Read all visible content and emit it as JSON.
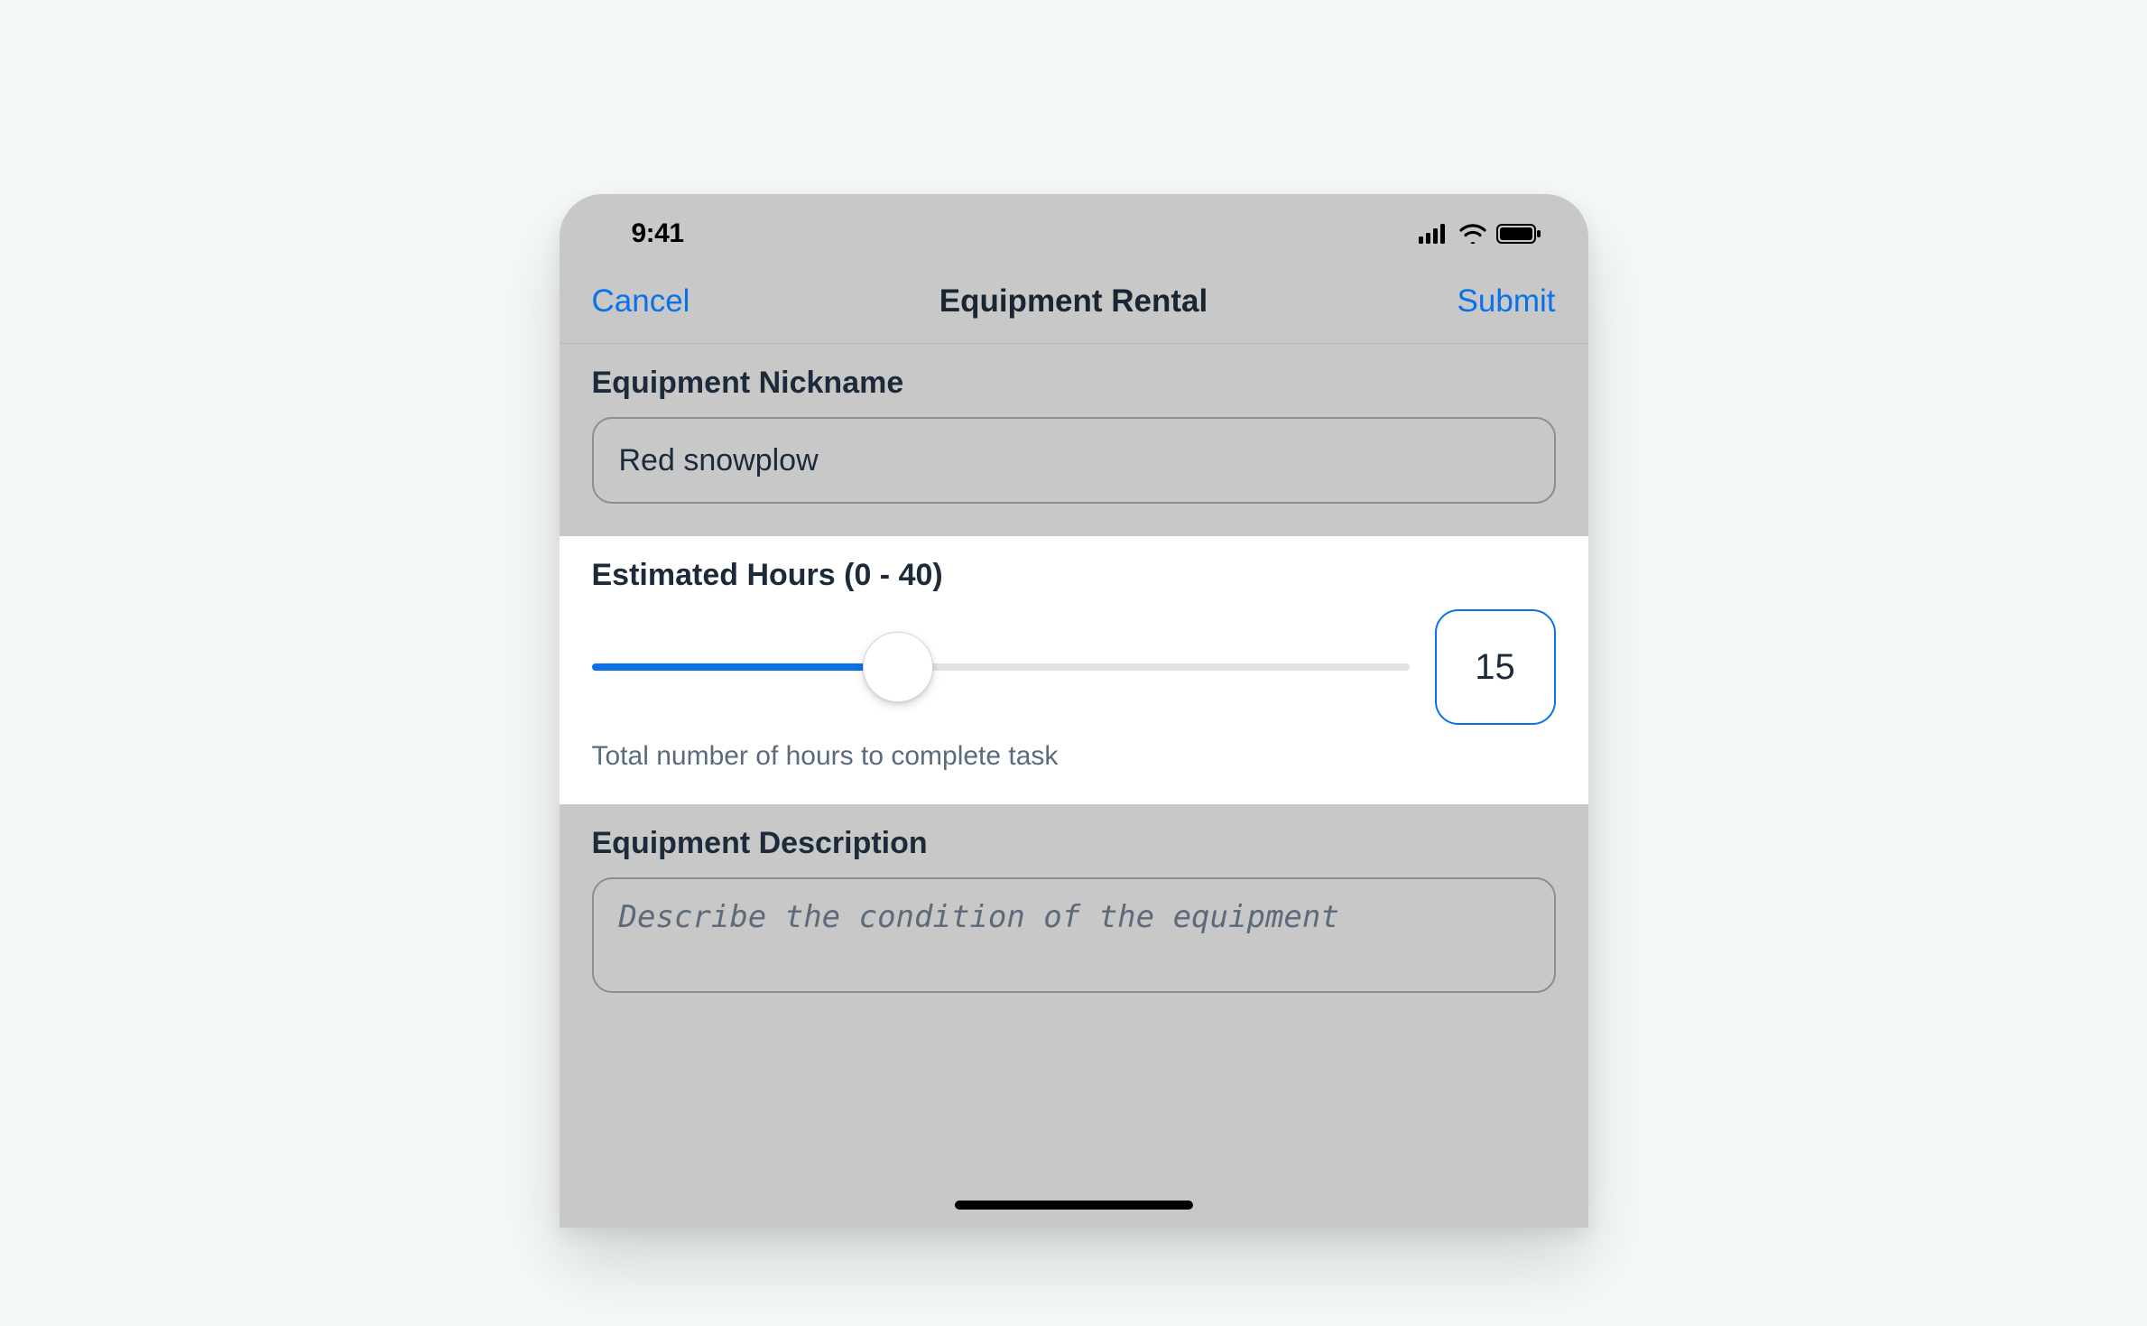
{
  "status": {
    "time": "9:41"
  },
  "nav": {
    "cancel": "Cancel",
    "title": "Equipment Rental",
    "submit": "Submit"
  },
  "nickname": {
    "label": "Equipment Nickname",
    "value": "Red snowplow"
  },
  "hours": {
    "label": "Estimated Hours (0 - 40)",
    "min": 0,
    "max": 40,
    "value": 15,
    "helper": "Total number of hours to complete task"
  },
  "description": {
    "label": "Equipment Description",
    "placeholder": "Describe the condition of the equipment"
  },
  "colors": {
    "accent": "#0a72e9",
    "panel_gray": "#c8c8c9",
    "text_dark": "#1c2a3a"
  }
}
